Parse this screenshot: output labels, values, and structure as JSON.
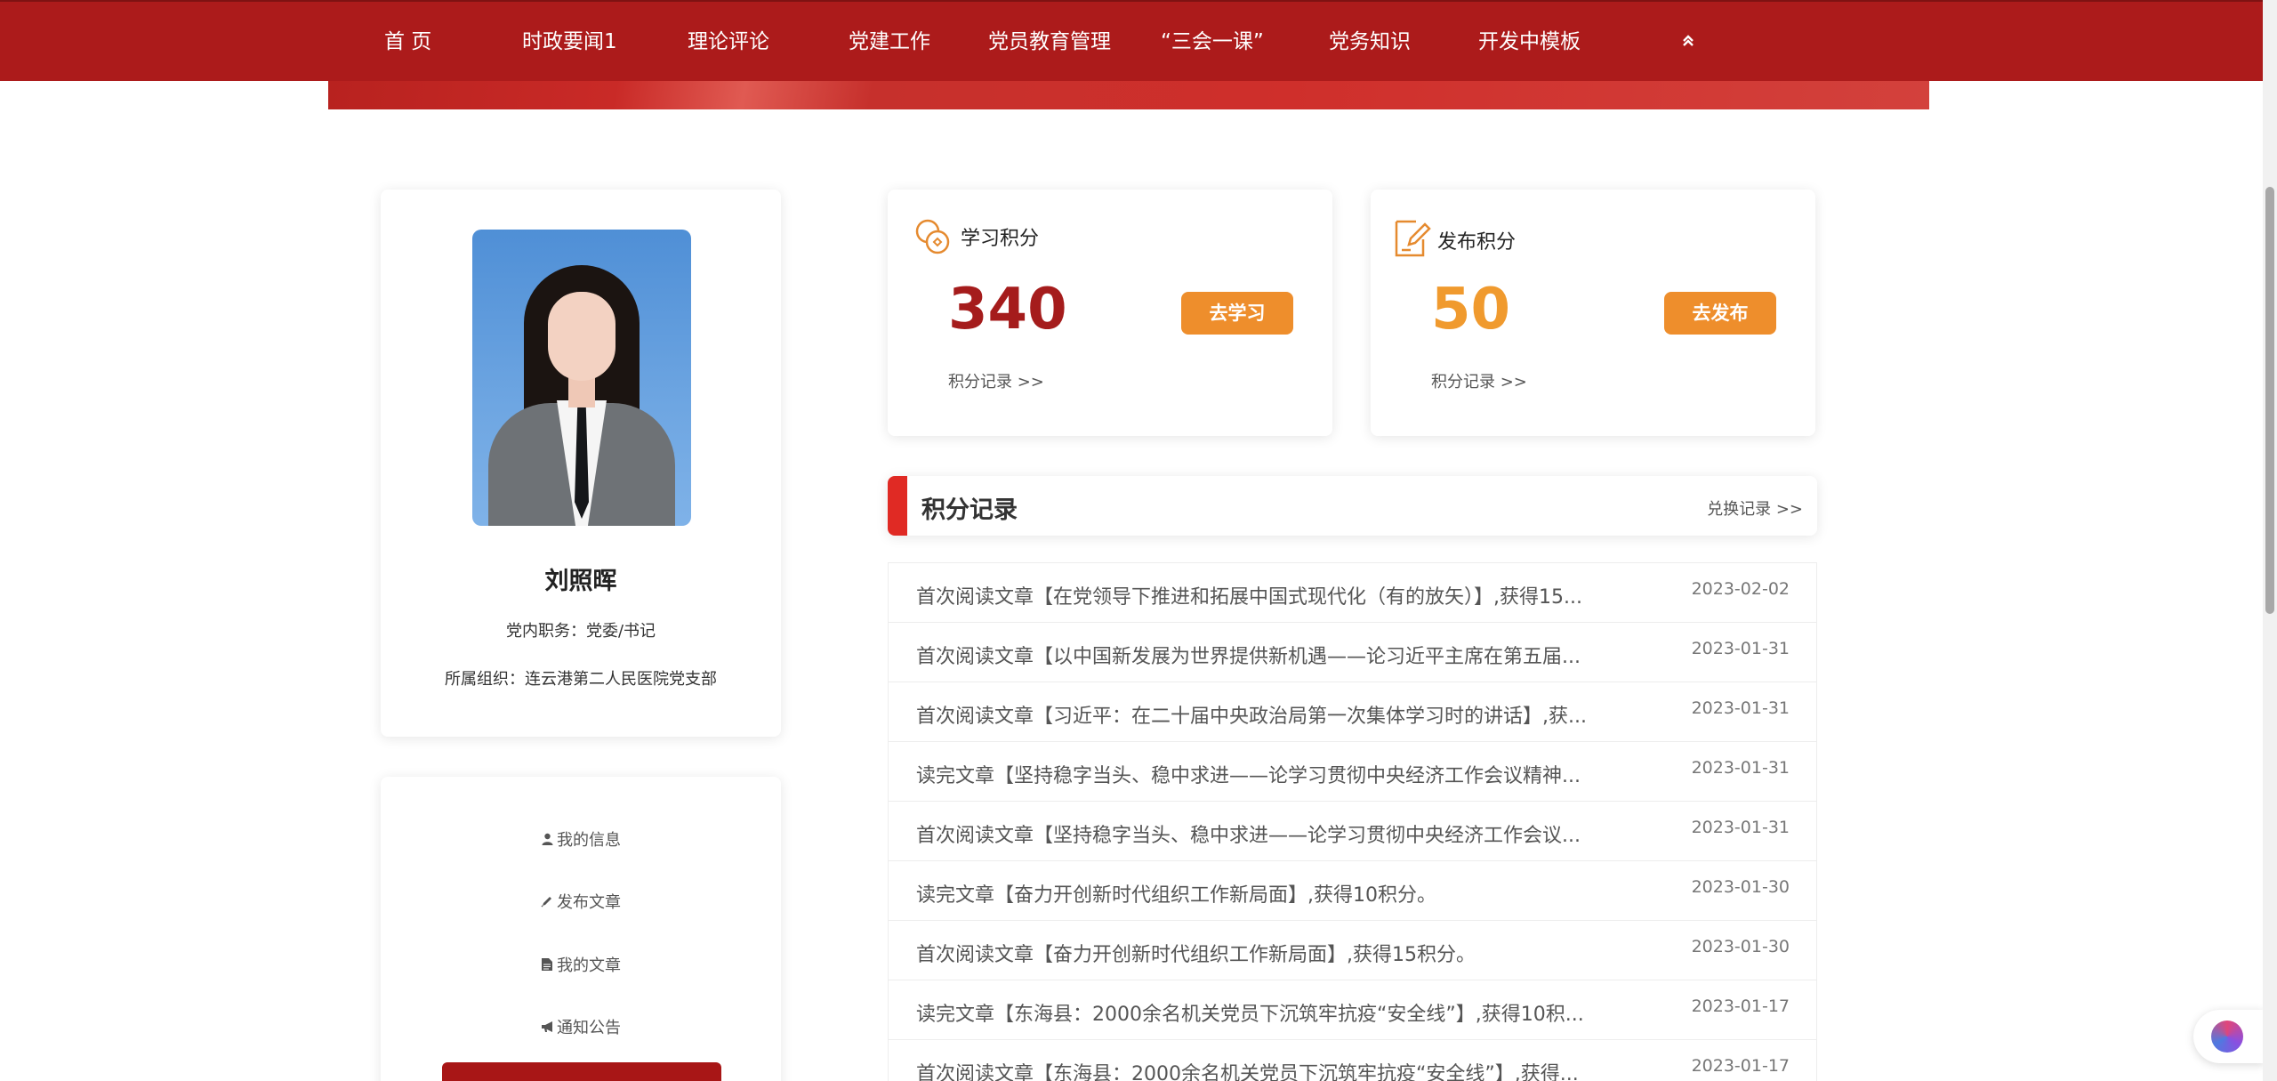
{
  "nav": {
    "items": [
      "首 页",
      "时政要闻1",
      "理论评论",
      "党建工作",
      "党员教育管理",
      "“三会一课”",
      "党务知识",
      "开发中模板"
    ],
    "collapse_icon": "double-chevron-up-icon"
  },
  "profile": {
    "name": "刘照晖",
    "position": "党内职务：党委/书记",
    "organization": "所属组织：连云港第二人民医院党支部"
  },
  "menu": {
    "items": [
      {
        "label": "我的信息",
        "icon": "user-icon"
      },
      {
        "label": "发布文章",
        "icon": "pencil-icon"
      },
      {
        "label": "我的文章",
        "icon": "file-icon"
      },
      {
        "label": "通知公告",
        "icon": "bullhorn-icon"
      }
    ]
  },
  "study_score": {
    "title": "学习积分",
    "value": "340",
    "button": "去学习",
    "record_link": "积分记录 >>",
    "color": "#a51c1c"
  },
  "publish_score": {
    "title": "发布积分",
    "value": "50",
    "button": "去发布",
    "record_link": "积分记录 >>",
    "color": "#f09a2e"
  },
  "records": {
    "title": "积分记录",
    "exchange_link": "兑换记录 >>",
    "rows": [
      {
        "text": "首次阅读文章【在党领导下推进和拓展中国式现代化（有的放矢）】,获得15...",
        "date": "2023-02-02"
      },
      {
        "text": "首次阅读文章【以中国新发展为世界提供新机遇——论习近平主席在第五届...",
        "date": "2023-01-31"
      },
      {
        "text": "首次阅读文章【习近平：在二十届中央政治局第一次集体学习时的讲话】,获...",
        "date": "2023-01-31"
      },
      {
        "text": "读完文章【坚持稳字当头、稳中求进——论学习贯彻中央经济工作会议精神...",
        "date": "2023-01-31"
      },
      {
        "text": "首次阅读文章【坚持稳字当头、稳中求进——论学习贯彻中央经济工作会议...",
        "date": "2023-01-31"
      },
      {
        "text": "读完文章【奋力开创新时代组织工作新局面】,获得10积分。",
        "date": "2023-01-30"
      },
      {
        "text": "首次阅读文章【奋力开创新时代组织工作新局面】,获得15积分。",
        "date": "2023-01-30"
      },
      {
        "text": "读完文章【东海县：2000余名机关党员下沉筑牢抗疫“安全线”】,获得10积...",
        "date": "2023-01-17"
      },
      {
        "text": "首次阅读文章【东海县：2000余名机关党员下沉筑牢抗疫“安全线”】,获得...",
        "date": "2023-01-17"
      }
    ]
  },
  "colors": {
    "nav_bg": "#ac1b1b",
    "accent_red": "#e02a24",
    "button_orange": "#ee8e2c"
  }
}
